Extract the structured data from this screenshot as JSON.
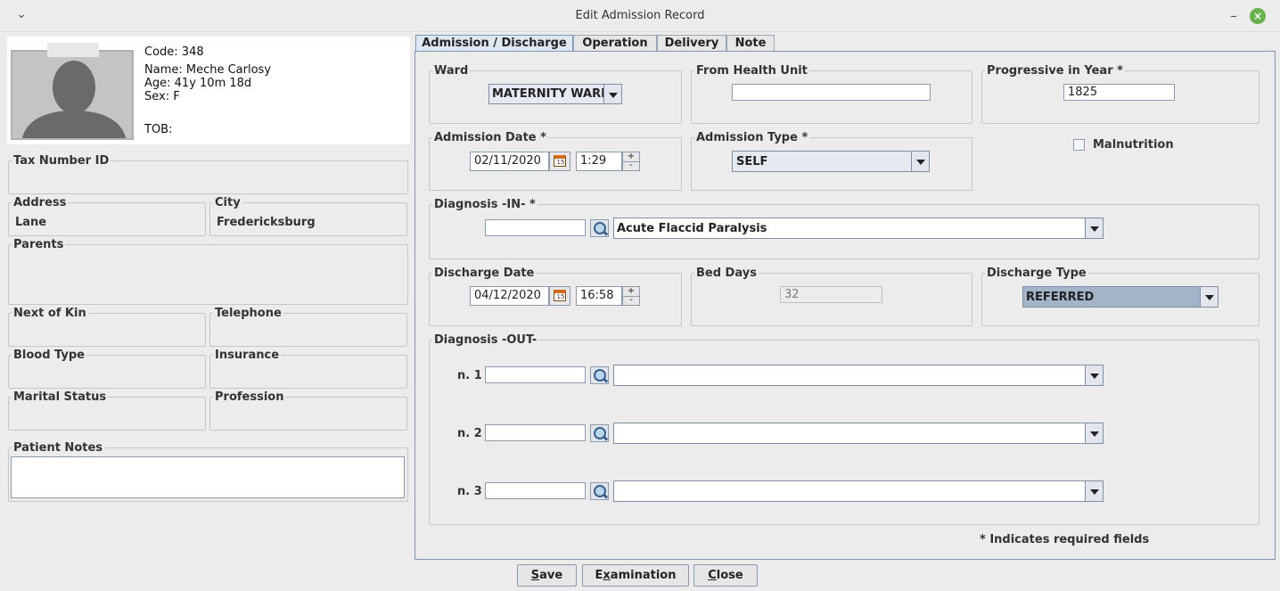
{
  "window": {
    "title": "Edit Admission Record"
  },
  "patient": {
    "code": "Code: 348",
    "name": "Name: Meche Carlosy",
    "age": "Age: 41y 10m 18d",
    "sex": "Sex: F",
    "tob": "TOB:",
    "fields": {
      "tax_label": "Tax Number ID",
      "tax_value": "",
      "address_label": "Address",
      "address_value": "Lane",
      "city_label": "City",
      "city_value": "Fredericksburg",
      "parents_label": "Parents",
      "parents_value": "",
      "kin_label": "Next of Kin",
      "kin_value": "",
      "telephone_label": "Telephone",
      "telephone_value": "",
      "blood_label": "Blood Type",
      "blood_value": "",
      "insurance_label": "Insurance",
      "insurance_value": "",
      "marital_label": "Marital Status",
      "marital_value": "",
      "profession_label": "Profession",
      "profession_value": "",
      "notes_label": "Patient Notes",
      "notes_value": ""
    }
  },
  "tabs": [
    "Admission / Discharge",
    "Operation",
    "Delivery",
    "Note"
  ],
  "admission": {
    "ward_label": "Ward",
    "ward_value": "MATERNITY WARD",
    "health_unit_label": "From Health Unit",
    "health_unit_value": "",
    "progressive_label": "Progressive in Year *",
    "progressive_value": "1825",
    "admission_date_label": "Admission Date *",
    "admission_date": "02/11/2020",
    "admission_time": "1:29",
    "admission_type_label": "Admission Type *",
    "admission_type_value": "SELF",
    "malnutrition_label": "Malnutrition",
    "diagnosis_in_label": "Diagnosis -IN- *",
    "diagnosis_in_code": "",
    "diagnosis_in_value": "Acute Flaccid Paralysis",
    "discharge_date_label": "Discharge Date",
    "discharge_date": "04/12/2020",
    "discharge_time": "16:58",
    "bed_days_label": "Bed Days",
    "bed_days_value": "32",
    "discharge_type_label": "Discharge Type",
    "discharge_type_value": "REFERRED",
    "diagnosis_out_label": "Diagnosis -OUT-",
    "diagnosis_out": [
      {
        "label": "n. 1",
        "code": "",
        "value": ""
      },
      {
        "label": "n. 2",
        "code": "",
        "value": ""
      },
      {
        "label": "n. 3",
        "code": "",
        "value": ""
      }
    ],
    "required_note": "* Indicates required fields"
  },
  "buttons": {
    "save_first": "S",
    "save_rest": "ave",
    "exam_first": "E",
    "exam_mid": "x",
    "exam_rest": "amination",
    "close_first": "C",
    "close_rest": "lose"
  }
}
